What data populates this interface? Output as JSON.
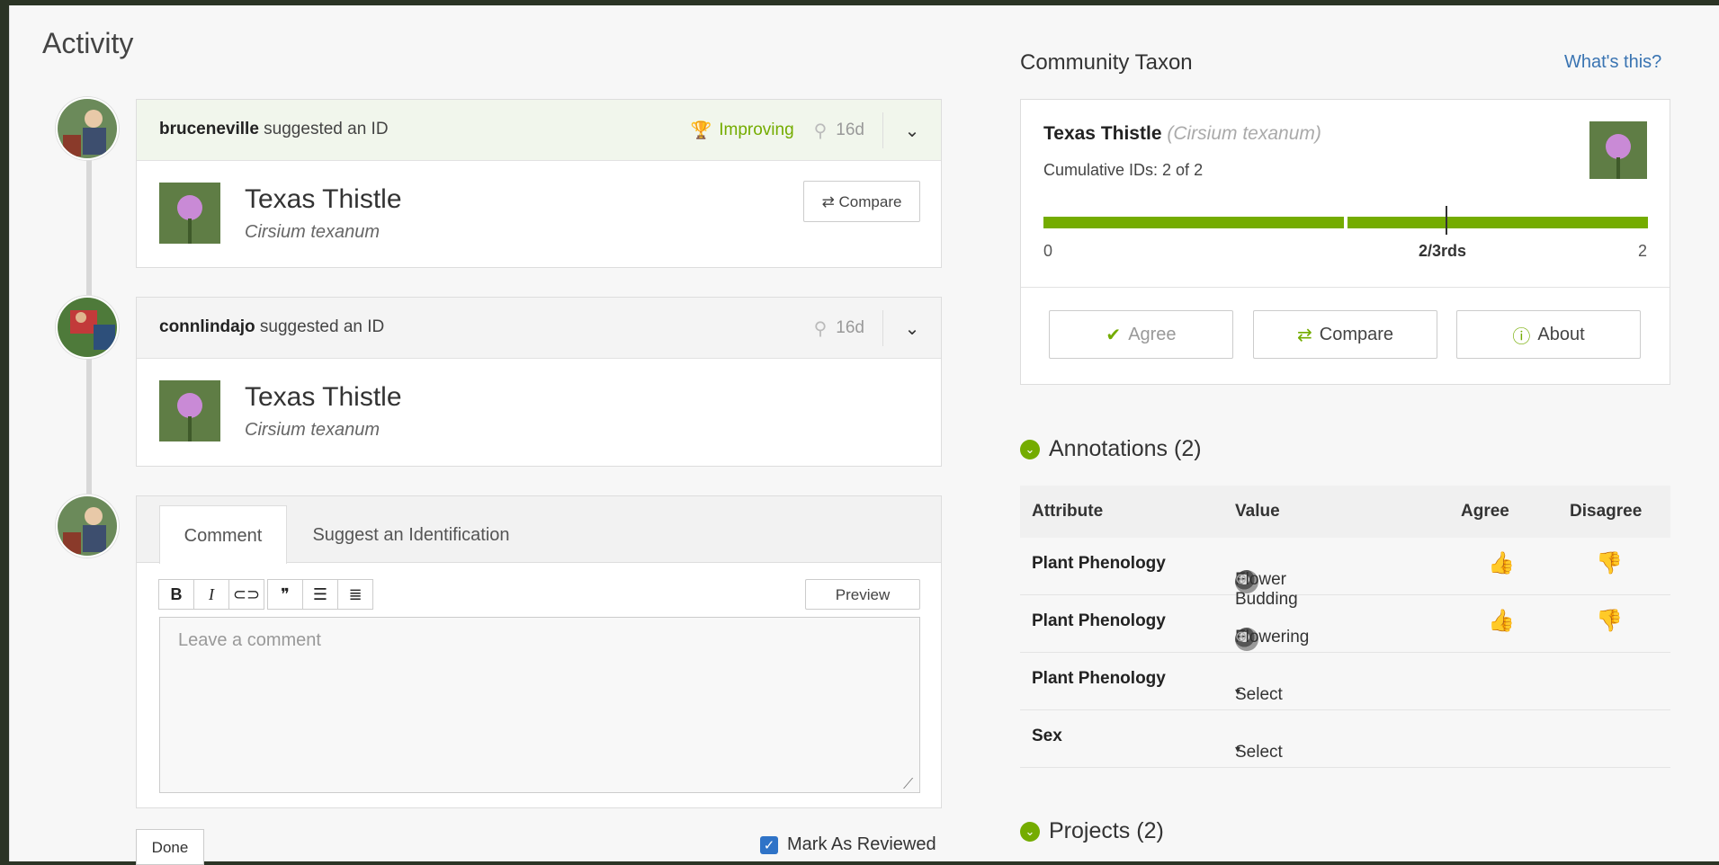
{
  "activity": {
    "title": "Activity",
    "identifications": [
      {
        "user": "bruceneville",
        "action": "suggested an ID",
        "status": "Improving",
        "age": "16d",
        "taxon_name": "Texas Thistle",
        "taxon_sci": "Cirsium texanum",
        "compare_label": "Compare"
      },
      {
        "user": "connlindajo",
        "action": "suggested an ID",
        "age": "16d",
        "taxon_name": "Texas Thistle",
        "taxon_sci": "Cirsium texanum"
      }
    ],
    "comment_box": {
      "tab_comment": "Comment",
      "tab_suggest": "Suggest an Identification",
      "preview_label": "Preview",
      "placeholder": "Leave a comment",
      "done_label": "Done",
      "mark_reviewed_label": "Mark As Reviewed"
    }
  },
  "community_taxon": {
    "title": "Community Taxon",
    "whats_this": "What's this?",
    "name": "Texas Thistle",
    "sci_name": "(Cirsium texanum)",
    "cumulative": "Cumulative IDs: 2 of 2",
    "progress": 1.0,
    "bar_min": "0",
    "bar_mid": "2/3rds",
    "bar_max": "2",
    "buttons": {
      "agree": "Agree",
      "compare": "Compare",
      "about": "About"
    }
  },
  "annotations": {
    "title": "Annotations (2)",
    "headers": [
      "Attribute",
      "Value",
      "Agree",
      "Disagree"
    ],
    "rows": [
      {
        "attribute": "Plant Phenology",
        "value": "Flower Budding"
      },
      {
        "attribute": "Plant Phenology",
        "value": "Flowering"
      },
      {
        "attribute": "Plant Phenology",
        "value": "Select"
      },
      {
        "attribute": "Sex",
        "value": "Select"
      }
    ]
  },
  "projects": {
    "title": "Projects (2)"
  },
  "colors": {
    "accent_green": "#74ac00",
    "link_blue": "#3a74b2"
  }
}
